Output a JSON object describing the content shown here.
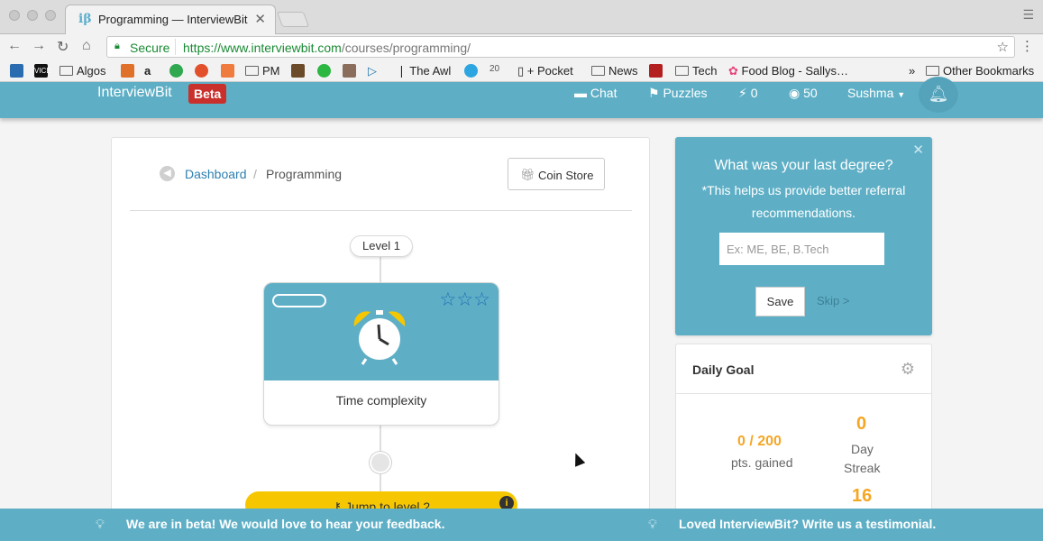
{
  "browser": {
    "tab_title": "Programming — InterviewBit",
    "tab_favicon": "iβ",
    "secure_label": "Secure",
    "url_host": "https://www.interviewbit.com",
    "url_path": "/courses/programming/"
  },
  "bookmarks": [
    {
      "label": "Algos"
    },
    {
      "label": "PM"
    },
    {
      "label": "The Awl"
    },
    {
      "label": "+ Pocket"
    },
    {
      "label": "News"
    },
    {
      "label": "Tech"
    },
    {
      "label": "Food Blog - Sallys…"
    },
    {
      "label": "Other Bookmarks"
    }
  ],
  "bookmark_more": "»",
  "header": {
    "brand": "InterviewBit",
    "beta_badge": "Beta",
    "chat_label": "Chat",
    "puzzles_label": "Puzzles",
    "bolt_count": "0",
    "coin_count": "50",
    "user_name": "Sushma"
  },
  "breadcrumb": {
    "dashboard": "Dashboard",
    "separator": "/",
    "current": "Programming"
  },
  "coin_store_label": "Coin Store",
  "level": {
    "label": "Level 1",
    "topic_label": "Time complexity",
    "stars": "☆☆☆",
    "jump_label": "Jump to level 2"
  },
  "degree": {
    "question": "What was your last degree?",
    "help_text": "*This helps us provide better referral recommendations.",
    "placeholder": "Ex: ME, BE, B.Tech",
    "save_label": "Save",
    "skip_label": "Skip >"
  },
  "daily_goal": {
    "title": "Daily Goal",
    "points": "0 / 200",
    "points_label": "pts. gained",
    "streak": "0",
    "streak_label_1": "Day",
    "streak_label_2": "Streak",
    "second_value": "16"
  },
  "footer": {
    "feedback": "We are in beta! We would love to hear your feedback.",
    "testimonial": "Loved InterviewBit? Write us a testimonial."
  },
  "colors": {
    "brand_blue": "#5eafc6",
    "beta_red": "#c9302c",
    "accent_orange": "#f5a623",
    "jump_yellow": "#f6c700"
  }
}
